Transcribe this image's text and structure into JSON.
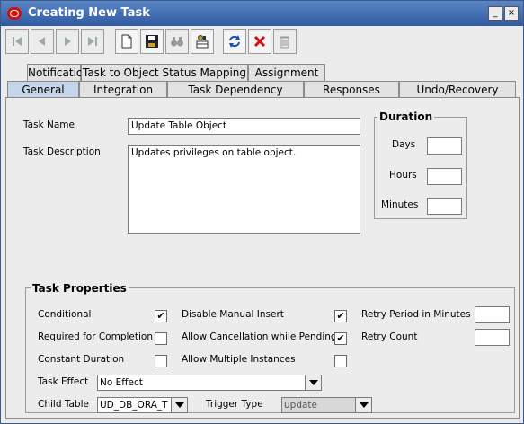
{
  "window": {
    "title": "Creating New Task"
  },
  "tabs_row1": [
    {
      "label": "Notification"
    },
    {
      "label": "Task to Object Status Mapping"
    },
    {
      "label": "Assignment"
    }
  ],
  "tabs_row2": [
    {
      "label": "General",
      "active": true
    },
    {
      "label": "Integration"
    },
    {
      "label": "Task Dependency"
    },
    {
      "label": "Responses"
    },
    {
      "label": "Undo/Recovery"
    }
  ],
  "form": {
    "task_name_label": "Task Name",
    "task_name_value": "Update Table Object",
    "task_description_label": "Task Description",
    "task_description_value": "Updates privileges on table object."
  },
  "duration": {
    "title": "Duration",
    "days_label": "Days",
    "hours_label": "Hours",
    "minutes_label": "Minutes",
    "days_value": "",
    "hours_value": "",
    "minutes_value": ""
  },
  "task_properties": {
    "title": "Task Properties",
    "conditional_label": "Conditional",
    "conditional_checked": "✔",
    "required_label": "Required for Completion",
    "required_checked": "",
    "constant_duration_label": "Constant Duration",
    "constant_duration_checked": "",
    "disable_manual_label": "Disable Manual Insert",
    "disable_manual_checked": "✔",
    "allow_cancel_label": "Allow Cancellation while Pending",
    "allow_cancel_checked": "✔",
    "allow_multiple_label": "Allow Multiple Instances",
    "allow_multiple_checked": "",
    "retry_period_label": "Retry Period in Minutes",
    "retry_period_value": "",
    "retry_count_label": "Retry Count",
    "retry_count_value": "",
    "task_effect_label": "Task Effect",
    "task_effect_value": "No Effect",
    "child_table_label": "Child Table",
    "child_table_value": "UD_DB_ORA_T",
    "trigger_type_label": "Trigger Type",
    "trigger_type_value": "update"
  },
  "colors": {
    "title_bar": "#2f5aa0",
    "active_tab": "#c5d6ea",
    "delete_red": "#d01010"
  }
}
